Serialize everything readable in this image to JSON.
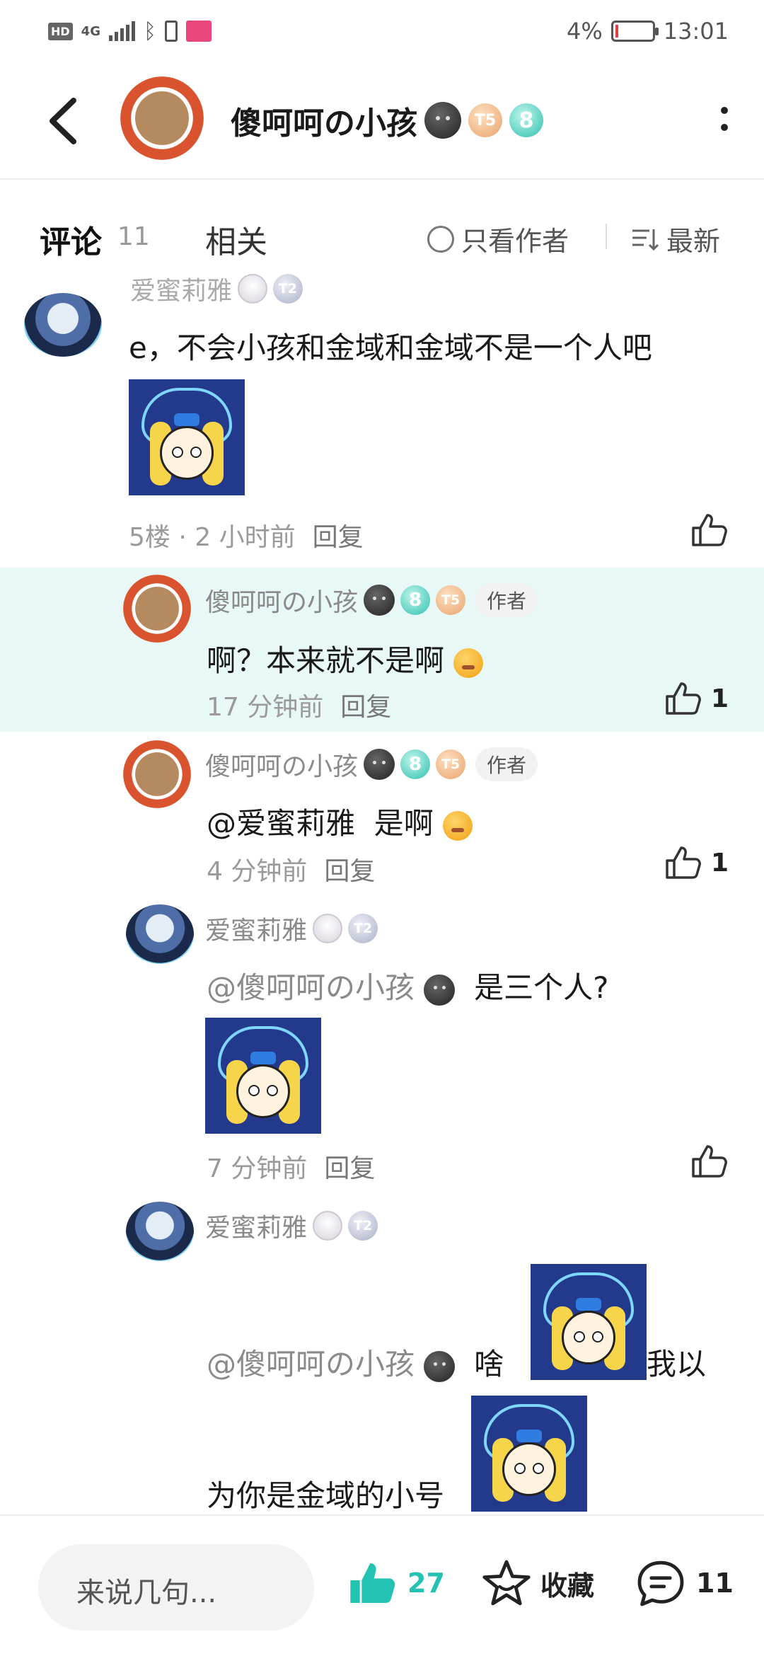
{
  "status_bar": {
    "hd": "HD",
    "net": "4G",
    "battery": "4%",
    "time": "13:01"
  },
  "header": {
    "title": "傻呵呵の小孩",
    "badge_t": "T5",
    "badge_8": "8"
  },
  "tabs": {
    "comment": "评论",
    "comment_count": "11",
    "related": "相关",
    "only_author": "只看作者",
    "sort": "最新"
  },
  "comments": [
    {
      "user": "爱蜜莉雅",
      "text": "e，不会小孩和金域和金域不是一个人吧",
      "floor": "5楼 · 2 小时前",
      "reply": "回复"
    },
    {
      "user": "傻呵呵の小孩",
      "author_tag": "作者",
      "text": "啊？本来就不是啊",
      "time": "17 分钟前",
      "reply": "回复",
      "likes": "1"
    },
    {
      "user": "傻呵呵の小孩",
      "author_tag": "作者",
      "mention": "@爱蜜莉雅",
      "text": "是啊",
      "time": "4 分钟前",
      "reply": "回复",
      "likes": "1"
    },
    {
      "user": "爱蜜莉雅",
      "mention": "@傻呵呵の小孩",
      "text": "是三个人?",
      "time": "7 分钟前",
      "reply": "回复"
    },
    {
      "user": "爱蜜莉雅",
      "mention": "@傻呵呵の小孩",
      "text_a": "啥",
      "text_b": "我以",
      "text_c": "为你是金域的小号"
    }
  ],
  "badges": {
    "t2": "T2",
    "t5": "T5",
    "eight": "8"
  },
  "bottom": {
    "input_placeholder": "来说几句...",
    "likes": "27",
    "fav": "收藏",
    "comments": "11"
  },
  "colors": {
    "accent": "#29cfbe",
    "highlight": "#e7f8f6"
  }
}
